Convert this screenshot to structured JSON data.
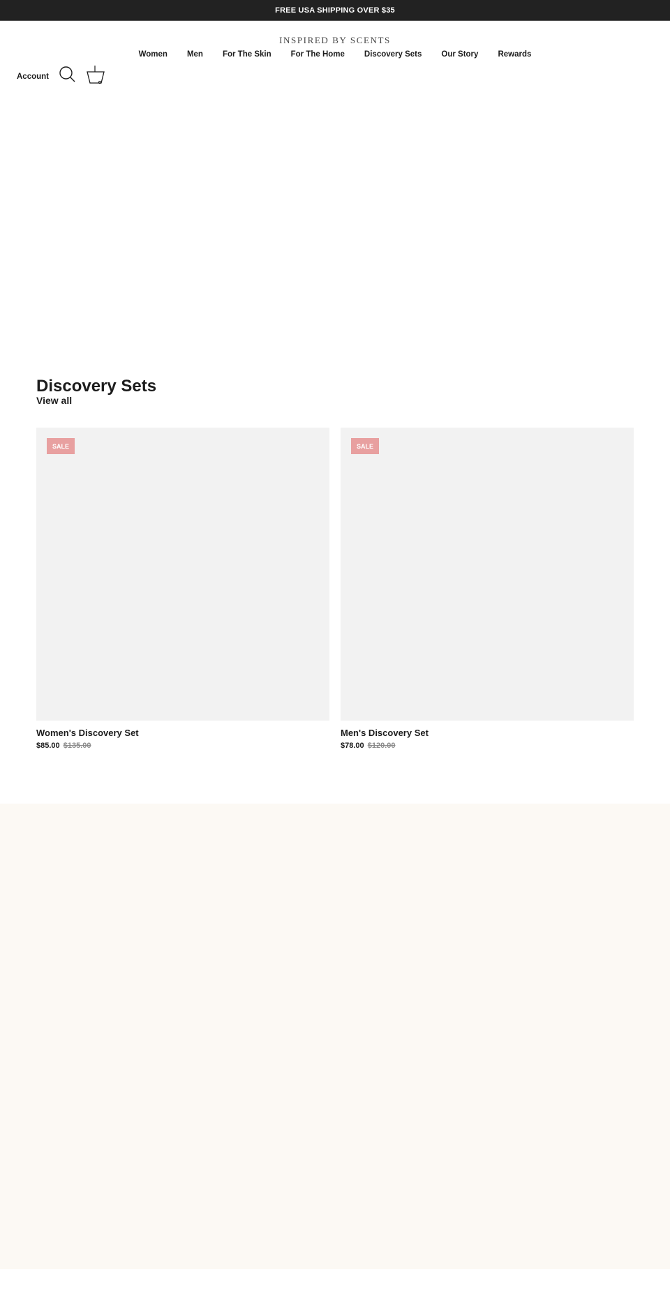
{
  "announcement": {
    "text": "FREE USA SHIPPING OVER $35"
  },
  "header": {
    "logo": "INSPIRED BY SCENTS",
    "nav": [
      {
        "label": "Women"
      },
      {
        "label": "Men"
      },
      {
        "label": "For The Skin"
      },
      {
        "label": "For The Home"
      },
      {
        "label": "Discovery Sets"
      },
      {
        "label": "Our Story"
      },
      {
        "label": "Rewards"
      }
    ],
    "account_label": "Account",
    "icons": {
      "search": "search-icon",
      "cart": "basket-icon"
    }
  },
  "collection": {
    "title": "Discovery Sets",
    "view_all": "View all",
    "products": [
      {
        "name": "Women's Discovery Set",
        "badge": "SALE",
        "price": "$85.00",
        "compare_at_price": "$135.00"
      },
      {
        "name": "Men's Discovery Set",
        "badge": "SALE",
        "price": "$78.00",
        "compare_at_price": "$120.00"
      }
    ]
  },
  "colors": {
    "announcement_bg": "#222222",
    "sale_badge": "#e8a0a0",
    "product_image_bg": "#f2f2f2",
    "cream_section_bg": "#fcf9f4"
  }
}
